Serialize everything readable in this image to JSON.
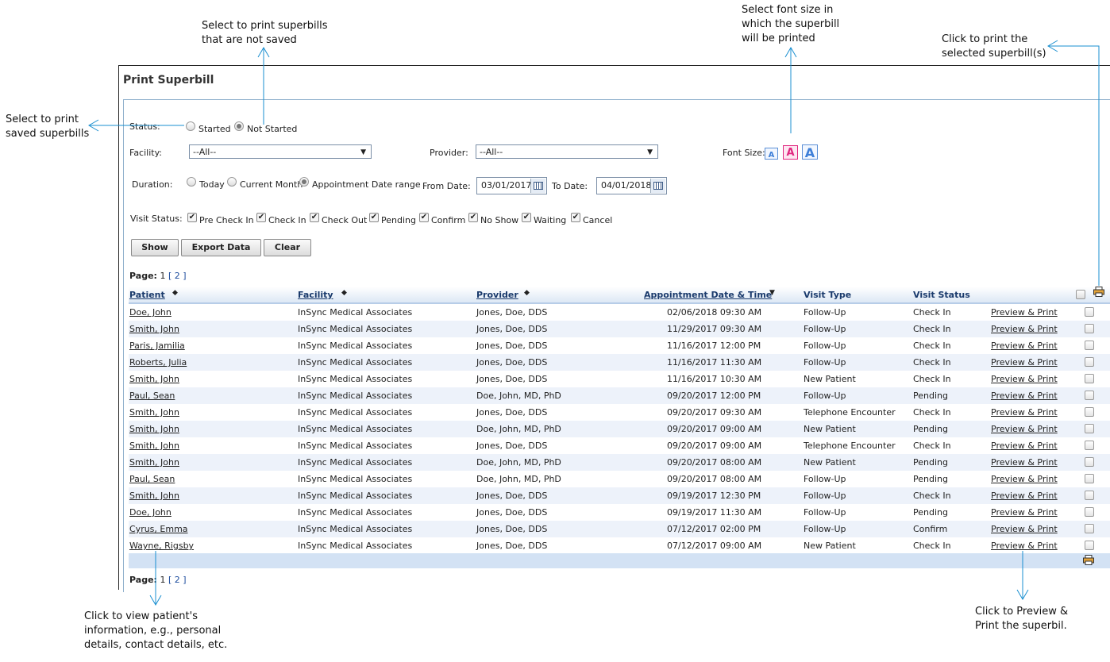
{
  "annotations": {
    "not_saved": [
      "Select to print superbills",
      "that are not saved"
    ],
    "font_size": [
      "Select font size in",
      "which the superbill",
      "will be printed"
    ],
    "print_selected": [
      "Click to print the",
      "selected superbill(s)"
    ],
    "saved": [
      "Select to print",
      "saved superbills"
    ],
    "patient_info": [
      "Click to view patient's",
      "information, e.g., personal",
      "details, contact details, etc."
    ],
    "preview_print": [
      "Click to Preview &",
      "Print the superbil."
    ]
  },
  "page": {
    "title": "Print Superbill"
  },
  "filters": {
    "status_label": "Status:",
    "status_options": [
      {
        "label": "Started",
        "selected": false
      },
      {
        "label": "Not Started",
        "selected": true
      }
    ],
    "facility_label": "Facility:",
    "facility_value": "--All--",
    "provider_label": "Provider:",
    "provider_value": "--All--",
    "font_size_label": "Font Size:",
    "font_sizes": [
      "A",
      "A",
      "A"
    ],
    "font_size_colors": {
      "small": "#3e7fd8",
      "medium": "#e0257e",
      "large": "#3e7fd8"
    },
    "duration_label": "Duration:",
    "duration_options": [
      {
        "label": "Today",
        "selected": false
      },
      {
        "label": "Current Month",
        "selected": false
      },
      {
        "label": "Appointment Date range",
        "selected": true
      }
    ],
    "from_date_label": "From Date:",
    "from_date_value": "03/01/2017",
    "to_date_label": "To Date:",
    "to_date_value": "04/01/2018",
    "visit_status_label": "Visit Status:",
    "visit_statuses": [
      {
        "label": "Pre Check In",
        "checked": true
      },
      {
        "label": "Check In",
        "checked": true
      },
      {
        "label": "Check Out",
        "checked": true
      },
      {
        "label": "Pending",
        "checked": true
      },
      {
        "label": "Confirm",
        "checked": true
      },
      {
        "label": "No Show",
        "checked": true
      },
      {
        "label": "Waiting",
        "checked": true
      },
      {
        "label": "Cancel",
        "checked": true
      }
    ]
  },
  "buttons": {
    "show": "Show",
    "export": "Export Data",
    "clear": "Clear"
  },
  "pagination": {
    "label": "Page:",
    "current": "1",
    "link": "[ 2 ]"
  },
  "table": {
    "headers": {
      "patient": "Patient",
      "facility": "Facility",
      "provider": "Provider",
      "appt": "Appointment Date & Time",
      "visit_type": "Visit Type",
      "visit_status": "Visit Status"
    },
    "action_label": "Preview & Print",
    "rows": [
      {
        "patient": "Doe, John",
        "facility": "InSync Medical Associates",
        "provider": "Jones, Doe, DDS",
        "datetime": "02/06/2018 09:30 AM",
        "visit_type": "Follow-Up",
        "visit_status": "Check In"
      },
      {
        "patient": "Smith, John",
        "facility": "InSync Medical Associates",
        "provider": "Jones, Doe, DDS",
        "datetime": "11/29/2017 09:30 AM",
        "visit_type": "Follow-Up",
        "visit_status": "Check In"
      },
      {
        "patient": "Paris, Jamilia",
        "facility": "InSync Medical Associates",
        "provider": "Jones, Doe, DDS",
        "datetime": "11/16/2017 12:00 PM",
        "visit_type": "Follow-Up",
        "visit_status": "Check In"
      },
      {
        "patient": "Roberts, Julia",
        "facility": "InSync Medical Associates",
        "provider": "Jones, Doe, DDS",
        "datetime": "11/16/2017 11:30 AM",
        "visit_type": "Follow-Up",
        "visit_status": "Check In"
      },
      {
        "patient": "Smith, John",
        "facility": "InSync Medical Associates",
        "provider": "Jones, Doe, DDS",
        "datetime": "11/16/2017 10:30 AM",
        "visit_type": "New Patient",
        "visit_status": "Check In"
      },
      {
        "patient": "Paul, Sean",
        "facility": "InSync Medical Associates",
        "provider": "Doe, John, MD, PhD",
        "datetime": "09/20/2017 12:00 PM",
        "visit_type": "Follow-Up",
        "visit_status": "Pending"
      },
      {
        "patient": "Smith, John",
        "facility": "InSync Medical Associates",
        "provider": "Jones, Doe, DDS",
        "datetime": "09/20/2017 09:30 AM",
        "visit_type": "Telephone Encounter",
        "visit_status": "Check In"
      },
      {
        "patient": "Smith, John",
        "facility": "InSync Medical Associates",
        "provider": "Doe, John, MD, PhD",
        "datetime": "09/20/2017 09:00 AM",
        "visit_type": "New Patient",
        "visit_status": "Pending"
      },
      {
        "patient": "Smith, John",
        "facility": "InSync Medical Associates",
        "provider": "Jones, Doe, DDS",
        "datetime": "09/20/2017 09:00 AM",
        "visit_type": "Telephone Encounter",
        "visit_status": "Check In"
      },
      {
        "patient": "Smith, John",
        "facility": "InSync Medical Associates",
        "provider": "Doe, John, MD, PhD",
        "datetime": "09/20/2017 08:00 AM",
        "visit_type": "New Patient",
        "visit_status": "Pending"
      },
      {
        "patient": "Paul, Sean",
        "facility": "InSync Medical Associates",
        "provider": "Doe, John, MD, PhD",
        "datetime": "09/20/2017 08:00 AM",
        "visit_type": "Follow-Up",
        "visit_status": "Pending"
      },
      {
        "patient": "Smith, John",
        "facility": "InSync Medical Associates",
        "provider": "Jones, Doe, DDS",
        "datetime": "09/19/2017 12:30 PM",
        "visit_type": "Follow-Up",
        "visit_status": "Check In"
      },
      {
        "patient": "Doe, John",
        "facility": "InSync Medical Associates",
        "provider": "Jones, Doe, DDS",
        "datetime": "09/19/2017 11:30 AM",
        "visit_type": "Follow-Up",
        "visit_status": "Pending"
      },
      {
        "patient": "Cyrus, Emma",
        "facility": "InSync Medical Associates",
        "provider": "Jones, Doe, DDS",
        "datetime": "07/12/2017 02:00 PM",
        "visit_type": "Follow-Up",
        "visit_status": "Confirm"
      },
      {
        "patient": "Wayne, Rigsby",
        "facility": "InSync Medical Associates",
        "provider": "Jones, Doe, DDS",
        "datetime": "07/12/2017 09:00 AM",
        "visit_type": "New Patient",
        "visit_status": "Check In"
      }
    ]
  },
  "icons": {
    "printer": "printer-icon",
    "calendar": "calendar-icon",
    "sort": "sort-arrows-icon"
  },
  "colors": {
    "annotation_arrow": "#1a8fd0",
    "header_link": "#1a3a6c",
    "row_alt": "#edf2fa",
    "footer_bar": "#d3e2f4"
  }
}
